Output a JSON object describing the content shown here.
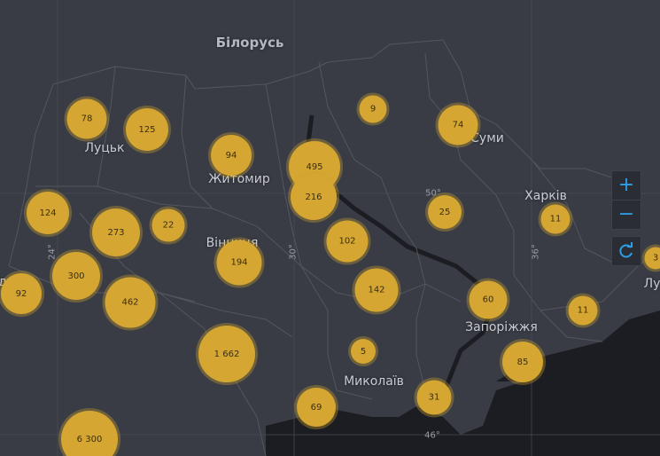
{
  "map": {
    "colors": {
      "background": "#3a3c45",
      "sea": "#1c1d22",
      "border": "#53565f",
      "cluster_fill": "#d6a632",
      "cluster_halo": "#cfa22c",
      "control_icon": "#2e9fe6"
    },
    "country_labels": [
      {
        "id": "belarus",
        "text": "Білорусь"
      }
    ],
    "city_labels": [
      {
        "id": "lutsk",
        "text": "Луцьк"
      },
      {
        "id": "zhytomyr",
        "text": "Житомир"
      },
      {
        "id": "vinnytsia",
        "text": "Вінниця"
      },
      {
        "id": "sumy",
        "text": "Суми"
      },
      {
        "id": "kharkiv",
        "text": "Харків"
      },
      {
        "id": "zaporizhzhia",
        "text": "Запоріжжя"
      },
      {
        "id": "mykolaiv",
        "text": "Миколаїв"
      },
      {
        "id": "luhansk-partial",
        "text": "Лу"
      }
    ],
    "grid_labels": [
      {
        "id": "lat-50",
        "text": "50°"
      },
      {
        "id": "lat-46",
        "text": "46°"
      },
      {
        "id": "lon-24",
        "text": "24°"
      },
      {
        "id": "lon-30",
        "text": "30°"
      },
      {
        "id": "lon-36",
        "text": "36°"
      }
    ],
    "edge_letter": "д",
    "clusters": [
      {
        "id": "c78",
        "label": "78",
        "value": 78
      },
      {
        "id": "c125",
        "label": "125",
        "value": 125
      },
      {
        "id": "c94",
        "label": "94",
        "value": 94
      },
      {
        "id": "c495",
        "label": "495",
        "value": 495
      },
      {
        "id": "c216",
        "label": "216",
        "value": 216
      },
      {
        "id": "c9",
        "label": "9",
        "value": 9
      },
      {
        "id": "c74",
        "label": "74",
        "value": 74
      },
      {
        "id": "c124",
        "label": "124",
        "value": 124
      },
      {
        "id": "c273",
        "label": "273",
        "value": 273
      },
      {
        "id": "c22",
        "label": "22",
        "value": 22
      },
      {
        "id": "c194",
        "label": "194",
        "value": 194
      },
      {
        "id": "c102",
        "label": "102",
        "value": 102
      },
      {
        "id": "c25",
        "label": "25",
        "value": 25
      },
      {
        "id": "c11a",
        "label": "11",
        "value": 11
      },
      {
        "id": "c300",
        "label": "300",
        "value": 300
      },
      {
        "id": "c92",
        "label": "92",
        "value": 92
      },
      {
        "id": "c462",
        "label": "462",
        "value": 462
      },
      {
        "id": "c142",
        "label": "142",
        "value": 142
      },
      {
        "id": "c60",
        "label": "60",
        "value": 60
      },
      {
        "id": "c11b",
        "label": "11",
        "value": 11
      },
      {
        "id": "c1662",
        "label": "1 662",
        "value": 1662
      },
      {
        "id": "c5",
        "label": "5",
        "value": 5
      },
      {
        "id": "c85",
        "label": "85",
        "value": 85
      },
      {
        "id": "c31",
        "label": "31",
        "value": 31
      },
      {
        "id": "c69",
        "label": "69",
        "value": 69
      },
      {
        "id": "c6300",
        "label": "6 300",
        "value": 6300
      },
      {
        "id": "c3partial",
        "label": "3",
        "value": 3
      }
    ],
    "controls": {
      "zoom_in": "+",
      "zoom_out": "−",
      "refresh_icon": "refresh-icon"
    }
  }
}
